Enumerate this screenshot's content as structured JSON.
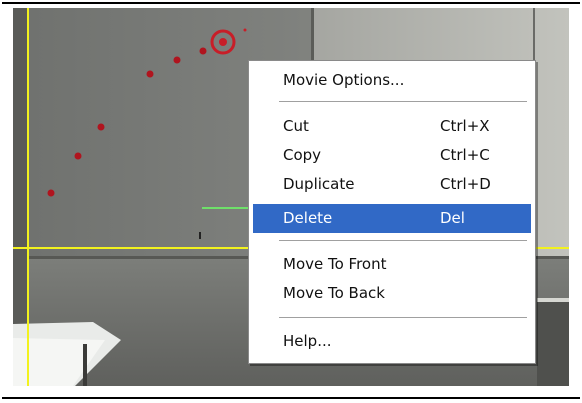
{
  "context_menu": {
    "items": [
      {
        "label": "Movie Options...",
        "shortcut": ""
      },
      {
        "label": "Cut",
        "shortcut": "Ctrl+X"
      },
      {
        "label": "Copy",
        "shortcut": "Ctrl+C"
      },
      {
        "label": "Duplicate",
        "shortcut": "Ctrl+D"
      },
      {
        "label": "Delete",
        "shortcut": "Del",
        "selected": true
      },
      {
        "label": "Move To Front",
        "shortcut": ""
      },
      {
        "label": "Move To Back",
        "shortcut": ""
      },
      {
        "label": "Help...",
        "shortcut": ""
      }
    ]
  },
  "colors": {
    "selection": "#3169c6",
    "crosshair": "#f2f21e",
    "track_points": "#b0141e",
    "marker": "#c81e28",
    "vector": "#6fe06a"
  }
}
